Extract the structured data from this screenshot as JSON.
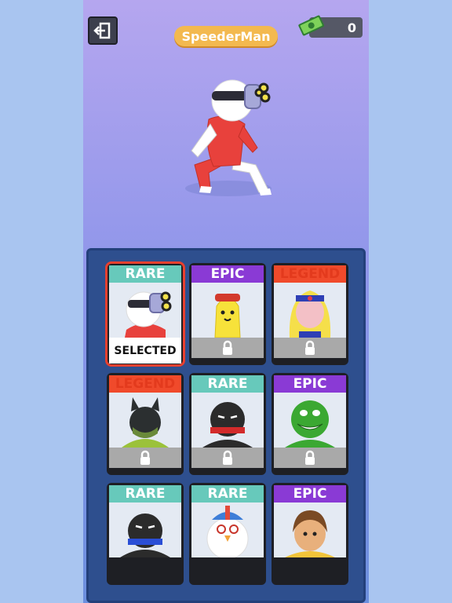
{
  "header": {
    "title": "SpeederMan",
    "cash": "0"
  },
  "cards": [
    {
      "rarity": "RARE",
      "tier": "rare",
      "status": "SELECTED",
      "icon": "speederman-portrait"
    },
    {
      "rarity": "EPIC",
      "tier": "epic",
      "status": "locked",
      "icon": "banana-portrait"
    },
    {
      "rarity": "LEGEND",
      "tier": "legend",
      "status": "locked",
      "icon": "blonde-hero-portrait"
    },
    {
      "rarity": "LEGEND",
      "tier": "legend",
      "status": "locked",
      "icon": "bat-hero-portrait"
    },
    {
      "rarity": "RARE",
      "tier": "rare",
      "status": "locked",
      "icon": "ninja-red-portrait"
    },
    {
      "rarity": "EPIC",
      "tier": "epic",
      "status": "locked",
      "icon": "green-monster-portrait"
    },
    {
      "rarity": "RARE",
      "tier": "rare",
      "status": "locked",
      "icon": "ninja-blue-portrait"
    },
    {
      "rarity": "RARE",
      "tier": "rare",
      "status": "locked",
      "icon": "chicken-portrait"
    },
    {
      "rarity": "EPIC",
      "tier": "epic",
      "status": "locked",
      "icon": "brown-hair-portrait"
    }
  ],
  "colors": {
    "rare": "#67c9bb",
    "epic": "#8a3ad5",
    "legend": "#f04a2b",
    "selected_border": "#e8402f",
    "panel": "#2e4f8e"
  }
}
